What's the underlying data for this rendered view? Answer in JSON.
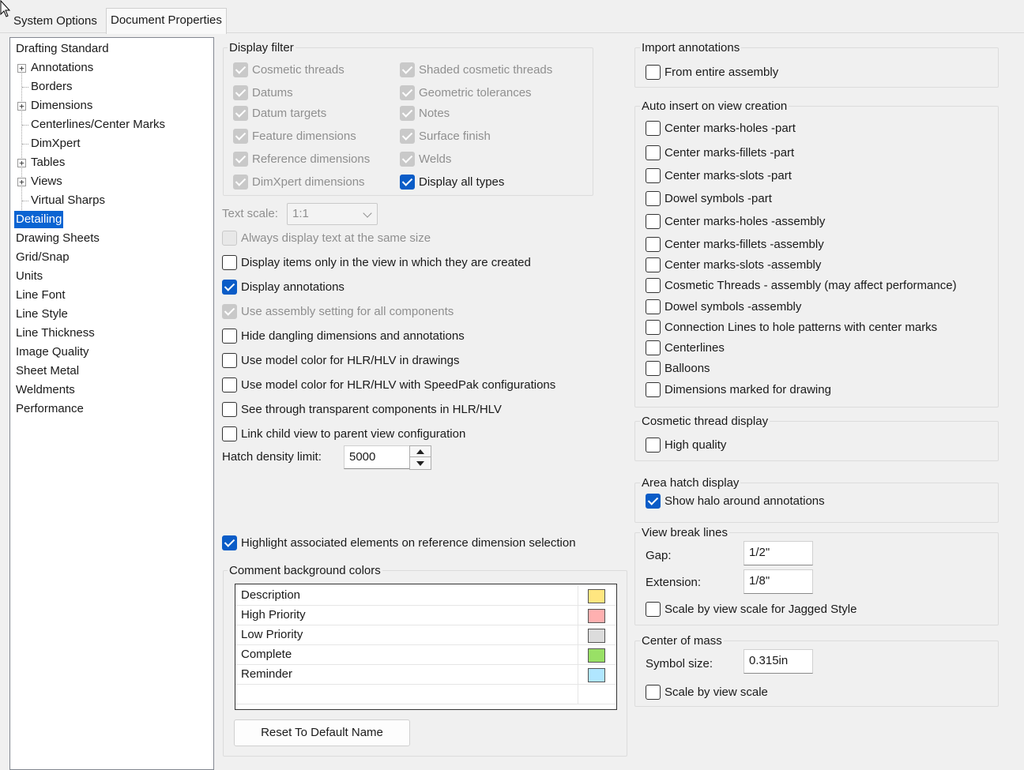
{
  "tabs": [
    {
      "label": "System Options",
      "active": false
    },
    {
      "label": "Document Properties",
      "active": true
    }
  ],
  "tree": {
    "items": [
      {
        "label": "Drafting Standard",
        "level": 0,
        "expandable": false,
        "selected": false
      },
      {
        "label": "Annotations",
        "level": 1,
        "expandable": true,
        "selected": false
      },
      {
        "label": "Borders",
        "level": 1,
        "expandable": false,
        "selected": false
      },
      {
        "label": "Dimensions",
        "level": 1,
        "expandable": true,
        "selected": false
      },
      {
        "label": "Centerlines/Center Marks",
        "level": 1,
        "expandable": false,
        "selected": false
      },
      {
        "label": "DimXpert",
        "level": 1,
        "expandable": false,
        "selected": false
      },
      {
        "label": "Tables",
        "level": 1,
        "expandable": true,
        "selected": false
      },
      {
        "label": "Views",
        "level": 1,
        "expandable": true,
        "selected": false
      },
      {
        "label": "Virtual Sharps",
        "level": 1,
        "expandable": false,
        "selected": false
      },
      {
        "label": "Detailing",
        "level": 0,
        "expandable": false,
        "selected": true
      },
      {
        "label": "Drawing Sheets",
        "level": 0,
        "expandable": false,
        "selected": false
      },
      {
        "label": "Grid/Snap",
        "level": 0,
        "expandable": false,
        "selected": false
      },
      {
        "label": "Units",
        "level": 0,
        "expandable": false,
        "selected": false
      },
      {
        "label": "Line Font",
        "level": 0,
        "expandable": false,
        "selected": false
      },
      {
        "label": "Line Style",
        "level": 0,
        "expandable": false,
        "selected": false
      },
      {
        "label": "Line Thickness",
        "level": 0,
        "expandable": false,
        "selected": false
      },
      {
        "label": "Image Quality",
        "level": 0,
        "expandable": false,
        "selected": false
      },
      {
        "label": "Sheet Metal",
        "level": 0,
        "expandable": false,
        "selected": false
      },
      {
        "label": "Weldments",
        "level": 0,
        "expandable": false,
        "selected": false
      },
      {
        "label": "Performance",
        "level": 0,
        "expandable": false,
        "selected": false
      }
    ]
  },
  "display_filter": {
    "title": "Display filter",
    "left": [
      {
        "label": "Cosmetic threads",
        "checked": true,
        "enabled": false
      },
      {
        "label": "Datums",
        "checked": true,
        "enabled": false
      },
      {
        "label": "Datum targets",
        "checked": true,
        "enabled": false
      },
      {
        "label": "Feature dimensions",
        "checked": true,
        "enabled": false
      },
      {
        "label": "Reference dimensions",
        "checked": true,
        "enabled": false
      },
      {
        "label": "DimXpert dimensions",
        "checked": true,
        "enabled": false
      }
    ],
    "right": [
      {
        "label": "Shaded cosmetic threads",
        "checked": true,
        "enabled": false
      },
      {
        "label": "Geometric tolerances",
        "checked": true,
        "enabled": false
      },
      {
        "label": "Notes",
        "checked": true,
        "enabled": false
      },
      {
        "label": "Surface finish",
        "checked": true,
        "enabled": false
      },
      {
        "label": "Welds",
        "checked": true,
        "enabled": false
      },
      {
        "label": "Display all types",
        "checked": true,
        "enabled": true
      }
    ]
  },
  "text_scale": {
    "label": "Text scale:",
    "value": "1:1",
    "enabled": false
  },
  "middle_options": [
    {
      "label": "Always display text at the same size",
      "checked": false,
      "enabled": false
    },
    {
      "label": "Display items only in the view in which they are created",
      "checked": false,
      "enabled": true
    },
    {
      "label": "Display annotations",
      "checked": true,
      "enabled": true
    },
    {
      "label": "Use assembly setting for all components",
      "checked": true,
      "enabled": false
    },
    {
      "label": "Hide dangling dimensions and annotations",
      "checked": false,
      "enabled": true
    },
    {
      "label": "Use model color for HLR/HLV in drawings",
      "checked": false,
      "enabled": true
    },
    {
      "label": "Use model color for HLR/HLV with SpeedPak configurations",
      "checked": false,
      "enabled": true
    },
    {
      "label": "See through transparent components in HLR/HLV",
      "checked": false,
      "enabled": true
    },
    {
      "label": "Link child view to parent view configuration",
      "checked": false,
      "enabled": true
    }
  ],
  "hatch_density": {
    "label": "Hatch density limit:",
    "value": "5000"
  },
  "highlight_option": {
    "label": "Highlight associated elements on reference dimension selection",
    "checked": true
  },
  "comment_colors": {
    "title": "Comment background colors",
    "rows": [
      {
        "name": "Description",
        "color": "#ffe680"
      },
      {
        "name": "High Priority",
        "color": "#ffb0b0"
      },
      {
        "name": "Low Priority",
        "color": "#dcdcdc"
      },
      {
        "name": "Complete",
        "color": "#99e066"
      },
      {
        "name": "Reminder",
        "color": "#b0e6ff"
      }
    ],
    "reset_label": "Reset To Default Name"
  },
  "import_annotations": {
    "title": "Import annotations",
    "options": [
      {
        "label": "From entire assembly",
        "checked": false
      }
    ]
  },
  "auto_insert": {
    "title": "Auto insert on view creation",
    "options": [
      {
        "label": "Center marks-holes -part",
        "checked": false
      },
      {
        "label": "Center marks-fillets -part",
        "checked": false
      },
      {
        "label": "Center marks-slots  -part",
        "checked": false
      },
      {
        "label": "Dowel symbols -part",
        "checked": false
      },
      {
        "label": "Center marks-holes -assembly",
        "checked": false
      },
      {
        "label": "Center marks-fillets -assembly",
        "checked": false
      },
      {
        "label": "Center marks-slots  -assembly",
        "checked": false
      },
      {
        "label": "Cosmetic Threads - assembly (may affect performance)",
        "checked": false
      },
      {
        "label": "Dowel symbols -assembly",
        "checked": false
      },
      {
        "label": "Connection Lines to hole patterns with center marks",
        "checked": false
      },
      {
        "label": "Centerlines",
        "checked": false
      },
      {
        "label": "Balloons",
        "checked": false
      },
      {
        "label": "Dimensions marked for drawing",
        "checked": false
      }
    ]
  },
  "cosmetic_thread_display": {
    "title": "Cosmetic thread display",
    "options": [
      {
        "label": "High quality",
        "checked": false
      }
    ]
  },
  "area_hatch_display": {
    "title": "Area hatch display",
    "options": [
      {
        "label": "Show halo around annotations",
        "checked": true
      }
    ]
  },
  "view_break_lines": {
    "title": "View break lines",
    "gap_label": "Gap:",
    "gap_value": "1/2\"",
    "extension_label": "Extension:",
    "extension_value": "1/8\"",
    "scale_option": {
      "label": "Scale by view scale for Jagged Style",
      "checked": false
    }
  },
  "center_of_mass": {
    "title": "Center of mass",
    "symbol_size_label": "Symbol size:",
    "symbol_size_value": "0.315in",
    "scale_option": {
      "label": "Scale by view scale",
      "checked": false
    }
  }
}
